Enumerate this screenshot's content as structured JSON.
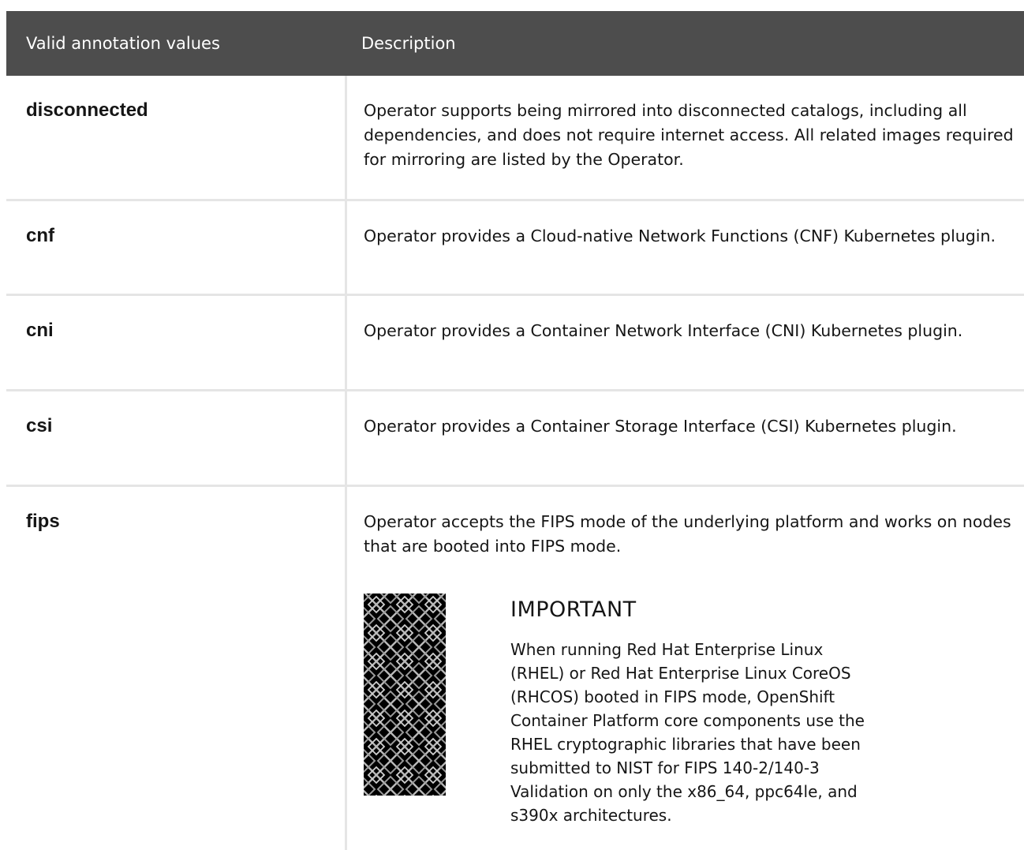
{
  "table": {
    "headers": {
      "name": "Valid annotation values",
      "description": "Description"
    },
    "rows": [
      {
        "name": "disconnected",
        "description": "Operator supports being mirrored into disconnected catalogs, including all dependencies, and does not require internet access. All related images required for mirroring are listed by the Operator."
      },
      {
        "name": "cnf",
        "description": "Operator provides a Cloud-native Network Functions (CNF) Kubernetes plugin."
      },
      {
        "name": "cni",
        "description": "Operator provides a Container Network Interface (CNI) Kubernetes plugin."
      },
      {
        "name": "csi",
        "description": "Operator provides a Container Storage Interface (CSI) Kubernetes plugin."
      },
      {
        "name": "fips",
        "description": "Operator accepts the FIPS mode of the underlying platform and works on nodes that are booted into FIPS mode.",
        "admonition": {
          "icon": "important-pattern-icon",
          "title": "IMPORTANT",
          "text": "When running Red Hat Enterprise Linux (RHEL) or Red Hat Enterprise Linux CoreOS (RHCOS) booted in FIPS mode, OpenShift Container Platform core components use the RHEL cryptographic libraries that have been submitted to NIST for FIPS 140-2/140-3 Validation on only the x86_64, ppc64le, and s390x architectures."
        }
      }
    ]
  },
  "colors": {
    "header_bg": "#4d4d4d",
    "header_text": "#ffffff",
    "border": "#e5e5e5",
    "text": "#151515"
  }
}
